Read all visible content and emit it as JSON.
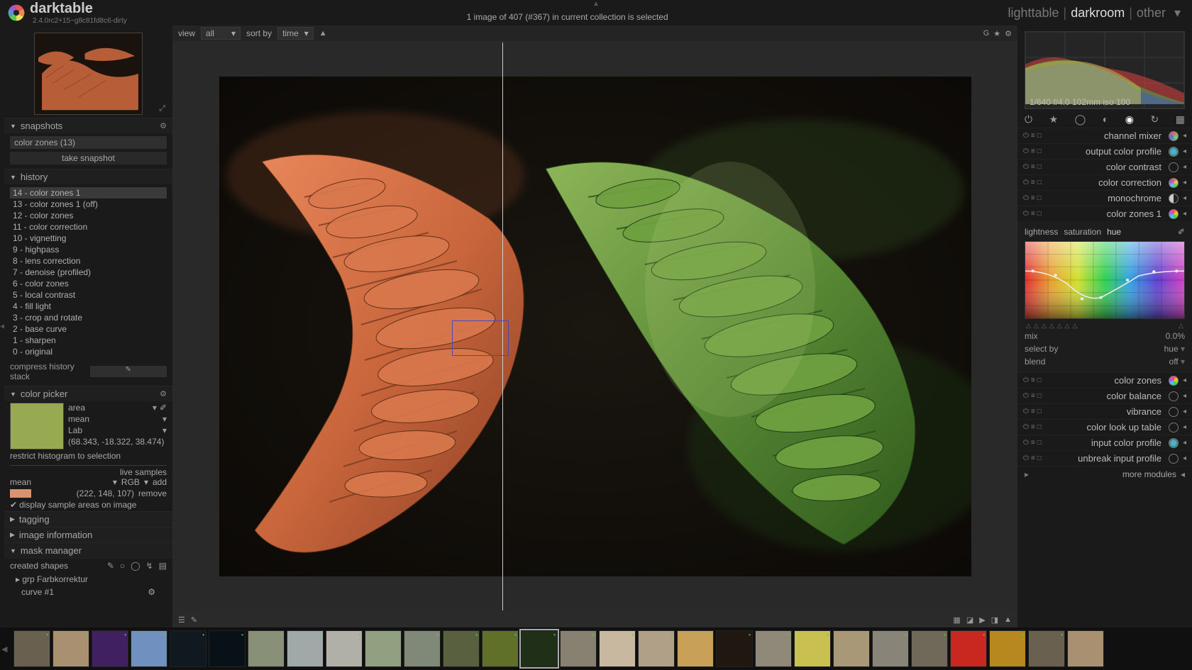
{
  "app": {
    "name": "darktable",
    "version": "2.4.0rc2+15~g8c81fd8c6-dirty"
  },
  "status": "1 image of 407 (#367) in current collection is selected",
  "views": {
    "lighttable": "lighttable",
    "darkroom": "darkroom",
    "other": "other",
    "active": "darkroom"
  },
  "viewbar": {
    "view_label": "view",
    "view_value": "all",
    "sortby_label": "sort by",
    "sortby_value": "time"
  },
  "snapshots": {
    "title": "snapshots",
    "item": "color zones (13)",
    "take": "take snapshot"
  },
  "history": {
    "title": "history",
    "items": [
      "14 - color zones 1",
      "13 - color zones 1 (off)",
      "12 - color zones",
      "11 - color correction",
      "10 - vignetting",
      "9 - highpass",
      "8 - lens correction",
      "7 - denoise (profiled)",
      "6 - color zones",
      "5 - local contrast",
      "4 - fill light",
      "3 - crop and rotate",
      "2 - base curve",
      "1 - sharpen",
      "0 - original"
    ],
    "compress": "compress history stack"
  },
  "color_picker": {
    "title": "color picker",
    "mode": "area",
    "stat": "mean",
    "space": "Lab",
    "lab_value": "(68.343, -18.322, 38.474)",
    "restrict": "restrict histogram to selection",
    "live_samples": "live samples",
    "hdr": {
      "stat": "mean",
      "mode": "RGB",
      "add": "add"
    },
    "sample_rgb": "(222, 148, 107)",
    "remove": "remove",
    "display": "display sample areas on image"
  },
  "tagging": "tagging",
  "image_info": "image information",
  "mask_manager": {
    "title": "mask manager",
    "created": "created shapes",
    "grp": "grp Farbkorrektur",
    "curve": "curve #1"
  },
  "histogram": {
    "exif": "1/640 f/4.0 102mm iso 100"
  },
  "module_groups": [
    "power",
    "star",
    "ring",
    "half",
    "color-on",
    "loop",
    "grid"
  ],
  "modules": [
    {
      "name": "channel mixer",
      "icon": "mixer"
    },
    {
      "name": "output color profile",
      "icon": "profile"
    },
    {
      "name": "color contrast",
      "icon": "circle"
    },
    {
      "name": "color correction",
      "icon": "cc"
    },
    {
      "name": "monochrome",
      "icon": "half"
    },
    {
      "name": "color zones 1",
      "icon": "cz",
      "expanded": true
    }
  ],
  "color_zones": {
    "tabs": {
      "lightness": "lightness",
      "saturation": "saturation",
      "hue": "hue"
    },
    "mix_label": "mix",
    "mix_value": "0.0%",
    "select_label": "select by",
    "select_value": "hue",
    "blend_label": "blend",
    "blend_value": "off"
  },
  "modules_below": [
    {
      "name": "color zones",
      "icon": "cz"
    },
    {
      "name": "color balance",
      "icon": "circle"
    },
    {
      "name": "vibrance",
      "icon": "circle"
    },
    {
      "name": "color look up table",
      "icon": "circle"
    },
    {
      "name": "input color profile",
      "icon": "profile"
    },
    {
      "name": "unbreak input profile",
      "icon": "circle"
    }
  ],
  "more_modules": "more modules"
}
